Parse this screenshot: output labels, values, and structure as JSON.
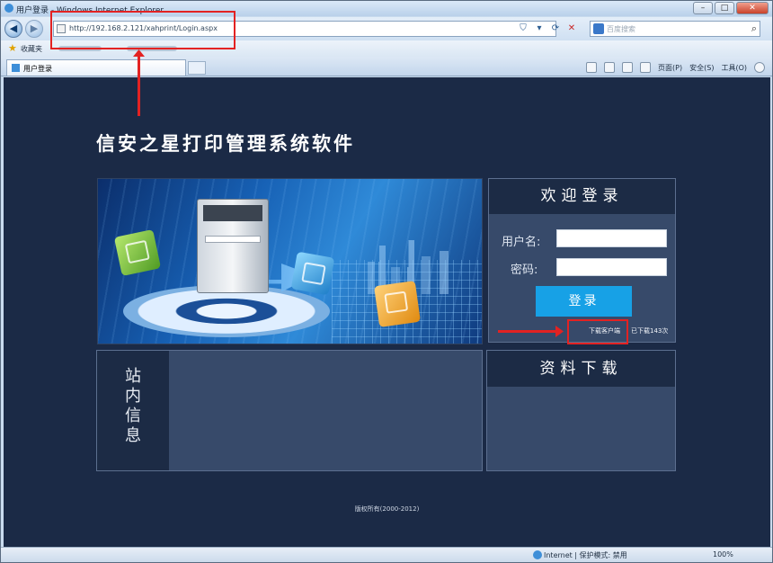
{
  "window": {
    "title": "用户登录 - Windows Internet Explorer",
    "minimize": "–",
    "maximize": "□",
    "close": "✕"
  },
  "address_bar": {
    "url": "http://192.168.2.121/xahprint/Login.aspx",
    "search_placeholder": "百度搜索"
  },
  "favorites_bar": {
    "label": "收藏夹"
  },
  "tab": {
    "label": "用户登录"
  },
  "command_bar": {
    "page": "页面(P)",
    "safety": "安全(S)",
    "tools": "工具(O)"
  },
  "page": {
    "title": "信安之星打印管理系统软件",
    "login": {
      "heading": "欢迎登录",
      "username_label": "用户名:",
      "password_label": "密码:",
      "username_value": "",
      "password_value": "",
      "submit_label": "登录",
      "download_client": "下载客户端",
      "download_count": "已下载143次"
    },
    "info": {
      "heading_chars": [
        "站",
        "内",
        "信",
        "息"
      ]
    },
    "download": {
      "heading": "资料下载"
    },
    "copyright": "版权所有(2000-2012)"
  },
  "status_bar": {
    "zone": "Internet | 保护模式: 禁用",
    "zoom": "100%"
  },
  "colors": {
    "page_bg": "#1b2a46",
    "panel_bg": "#374a6a",
    "panel_header": "#1c2b45",
    "login_button": "#17a1e6",
    "annotation": "#e32222"
  }
}
